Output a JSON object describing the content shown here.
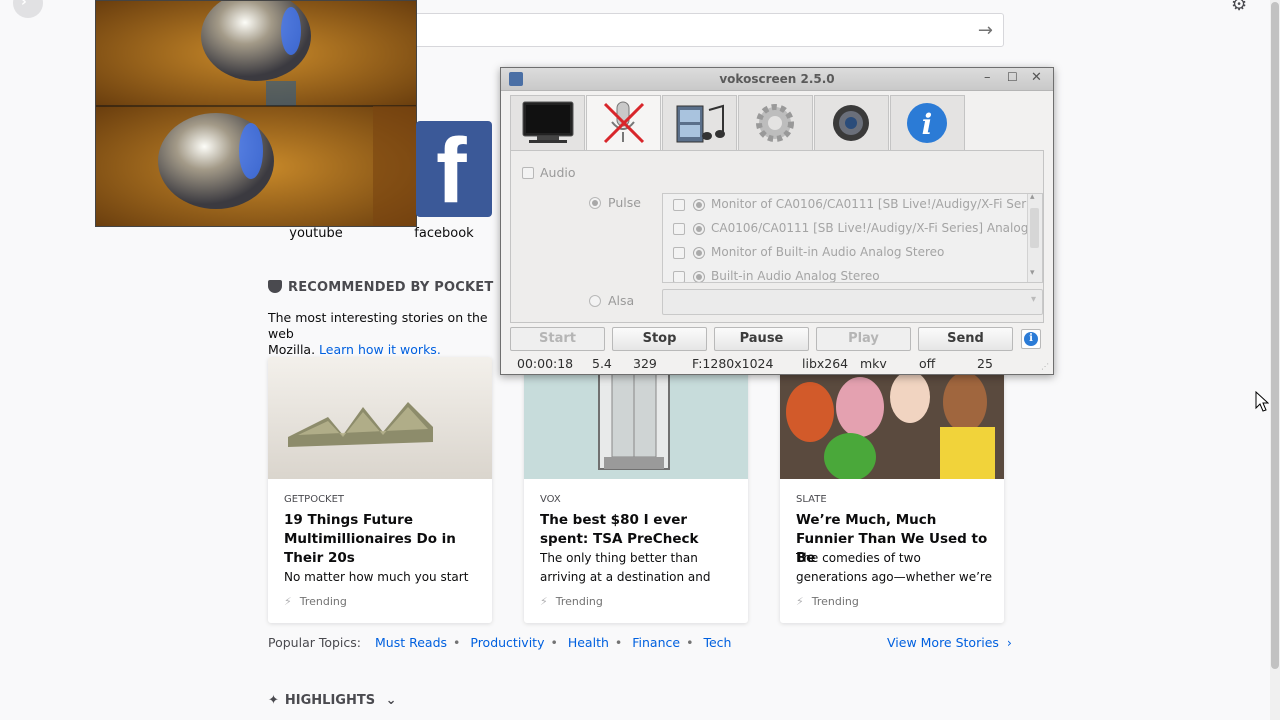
{
  "browser": {
    "search_arrow": "→",
    "gear": "⚙",
    "sites": [
      {
        "label": "youtube"
      },
      {
        "label": "facebook"
      }
    ],
    "pocket": {
      "heading": "RECOMMENDED BY POCKET",
      "intro": "The most interesting stories on the web",
      "intro_tail": "Mozilla.",
      "learn_link": "Learn how it works.",
      "cards": [
        {
          "source": "GETPOCKET",
          "title": "19 Things Future Multimillionaires Do in Their 20s",
          "desc": "No matter how much you start out",
          "trend": "Trending"
        },
        {
          "source": "VOX",
          "title": "The best $80 I ever spent: TSA PreCheck",
          "desc": "The only thing better than arriving at a destination and finding no line",
          "trend": "Trending"
        },
        {
          "source": "SLATE",
          "title": "We’re Much, Much Funnier Than We Used to Be",
          "desc": "The comedies of two generations ago—whether we’re talking about",
          "trend": "Trending"
        }
      ],
      "popular_label": "Popular Topics:",
      "topics": [
        "Must Reads",
        "Productivity",
        "Health",
        "Finance",
        "Tech"
      ],
      "view_more": "View More Stories"
    },
    "highlights": "HIGHLIGHTS"
  },
  "vokoscreen": {
    "title": "vokoscreen 2.5.0",
    "audio_label": "Audio",
    "pulse_label": "Pulse",
    "alsa_label": "Alsa",
    "devices": [
      "Monitor of CA0106/CA0111 [SB Live!/Audigy/X-Fi Ser",
      "CA0106/CA0111 [SB Live!/Audigy/X-Fi Series] Analog",
      "Monitor of Built-in Audio Analog Stereo",
      "Built-in Audio Analog Stereo"
    ],
    "buttons": {
      "start": "Start",
      "stop": "Stop",
      "pause": "Pause",
      "play": "Play",
      "send": "Send"
    },
    "status": {
      "time": "00:00:18",
      "fps_actual": "5.4",
      "frames": "329",
      "resolution": "F:1280x1024",
      "codec": "libx264",
      "container": "mkv",
      "audio": "off",
      "fps": "25"
    }
  }
}
